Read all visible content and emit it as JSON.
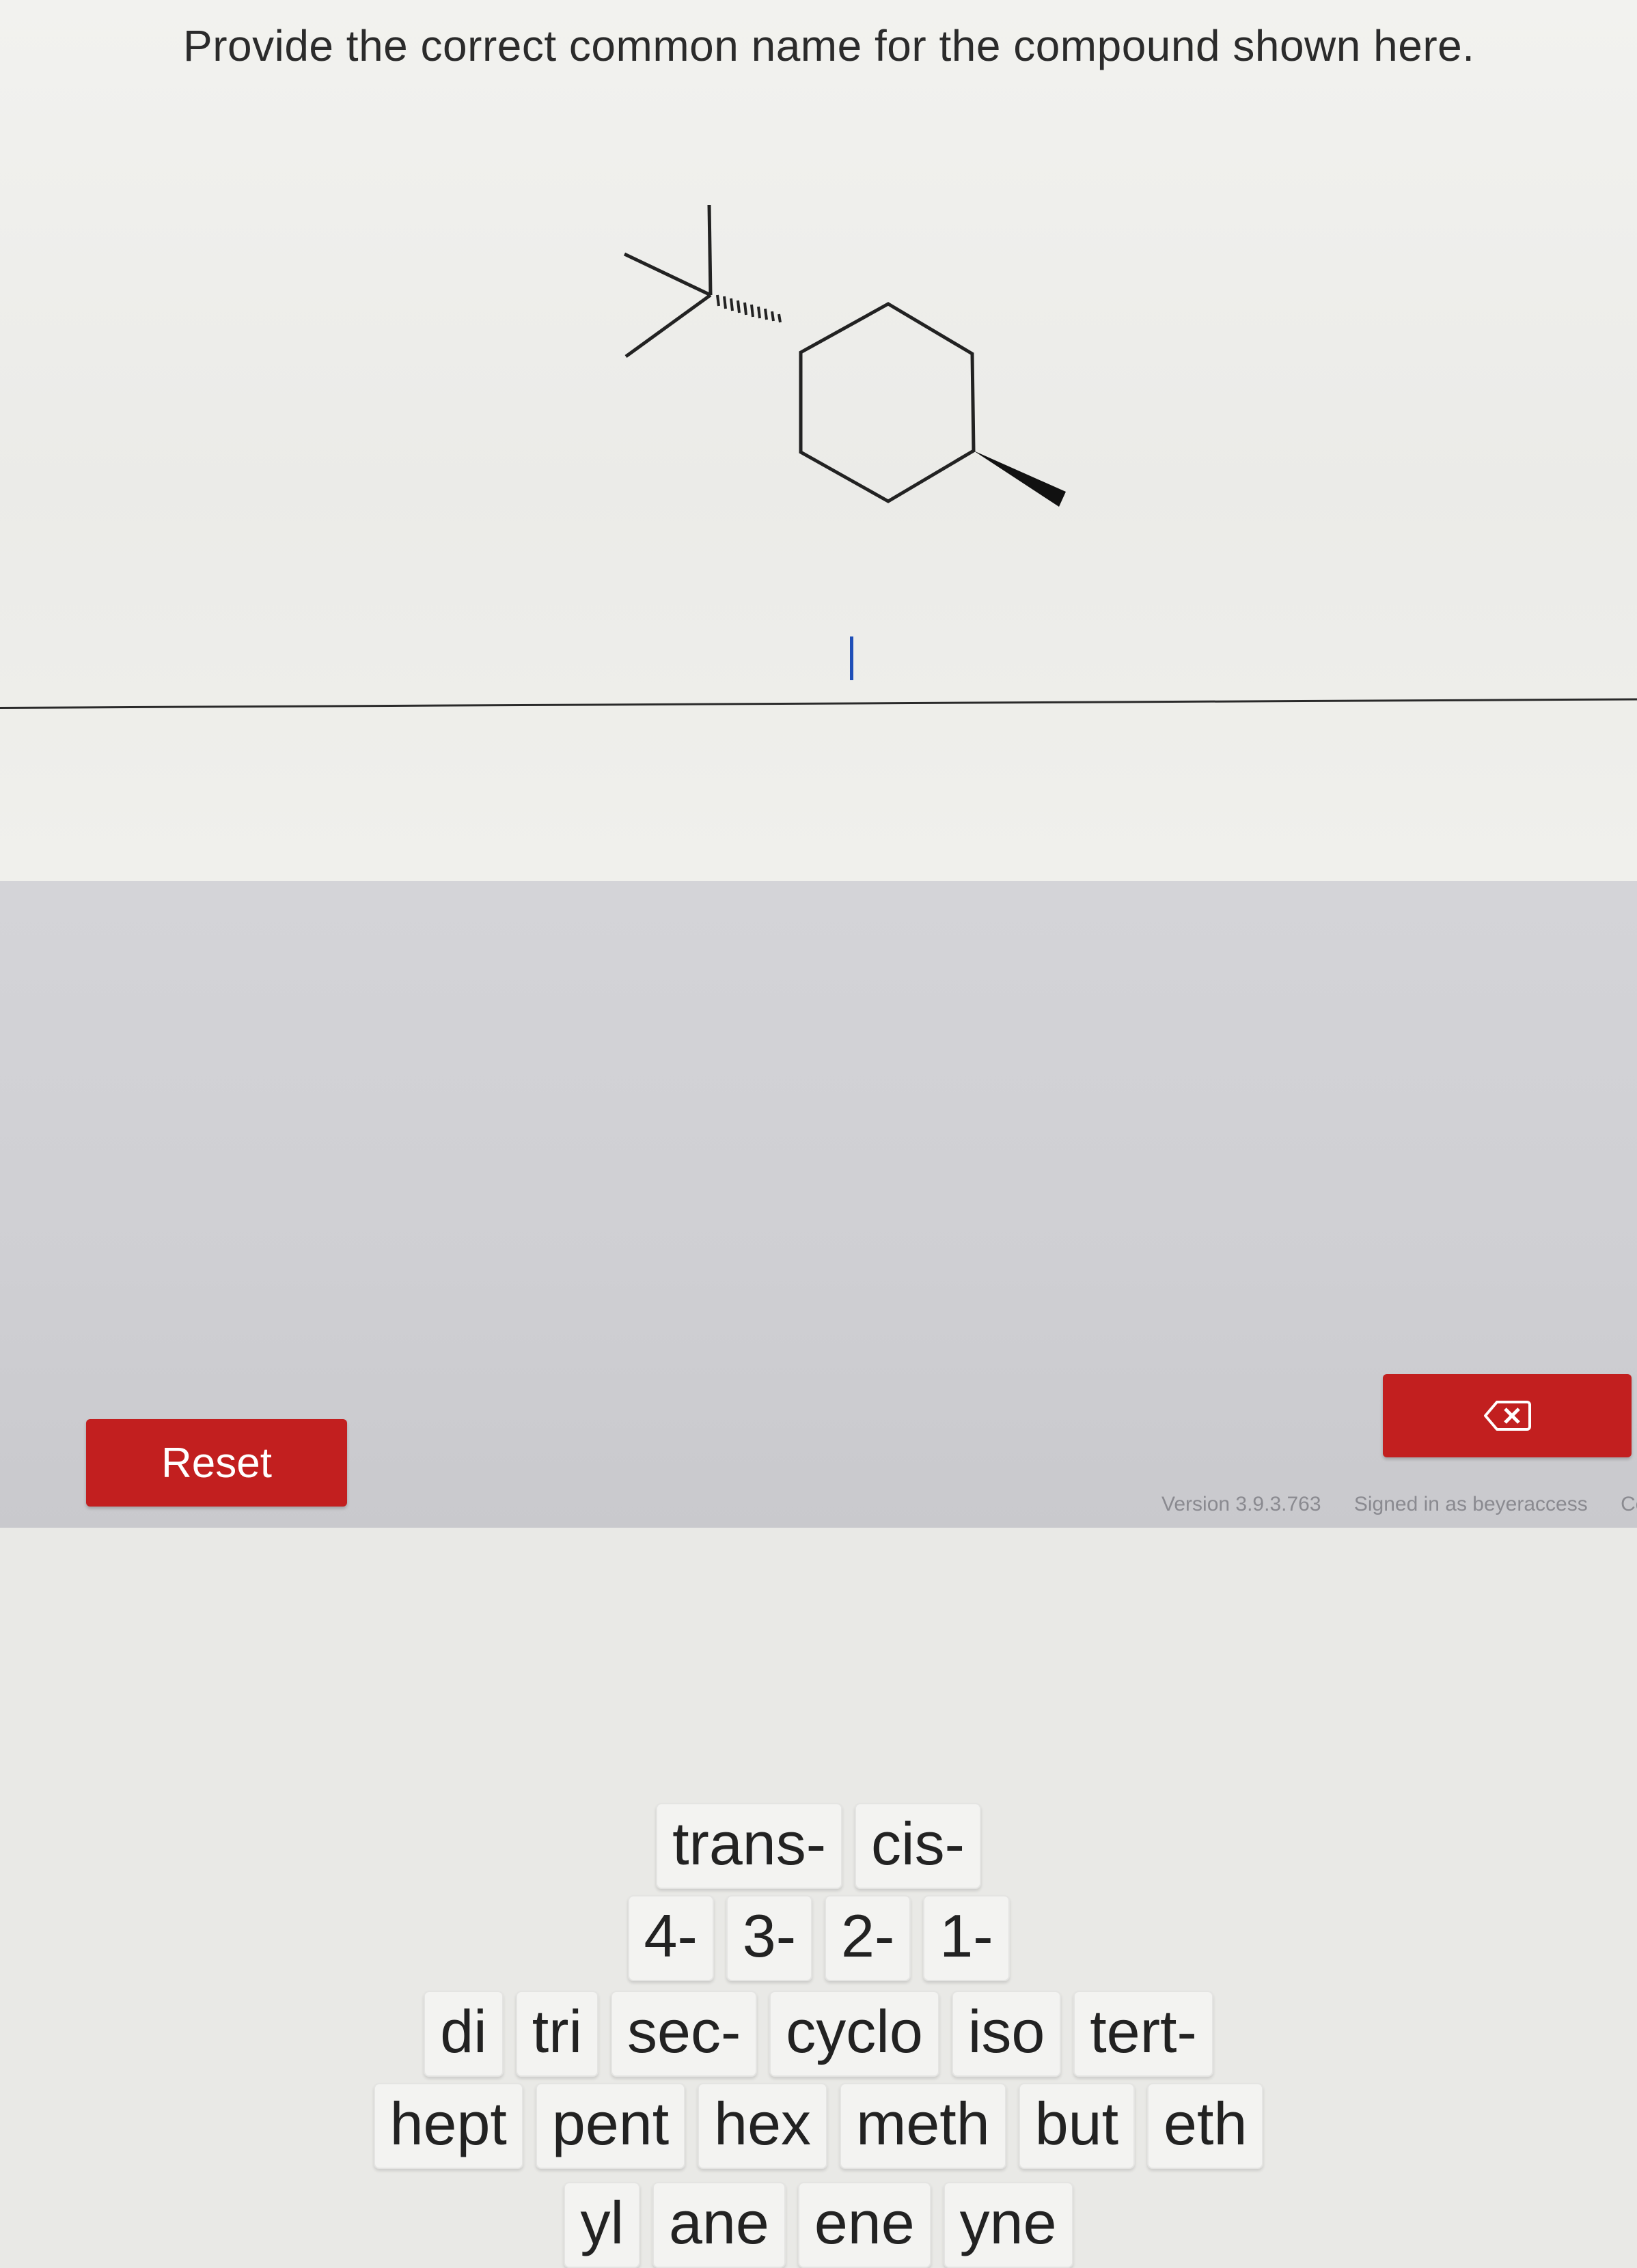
{
  "question": {
    "prompt": "Provide the correct common name for the compound shown here."
  },
  "tiles": {
    "row1": [
      "trans-",
      "cis-"
    ],
    "row2": [
      "4-",
      "3-",
      "2-",
      "1-"
    ],
    "row3": [
      "di",
      "tri",
      "sec-",
      "cyclo",
      "iso",
      "tert-"
    ],
    "row4": [
      "hept",
      "pent",
      "hex",
      "meth",
      "but",
      "eth"
    ],
    "row5": [
      "yl",
      "ane",
      "ene",
      "yne"
    ]
  },
  "controls": {
    "reset_label": "Reset",
    "backspace_icon": "backspace-icon"
  },
  "footer": {
    "version": "Version 3.9.3.763",
    "signed_in": "Signed in as beyeraccess",
    "trailing": "Comp"
  },
  "colors": {
    "button_red": "#c21f1f",
    "cursor_blue": "#1f4fb8"
  }
}
